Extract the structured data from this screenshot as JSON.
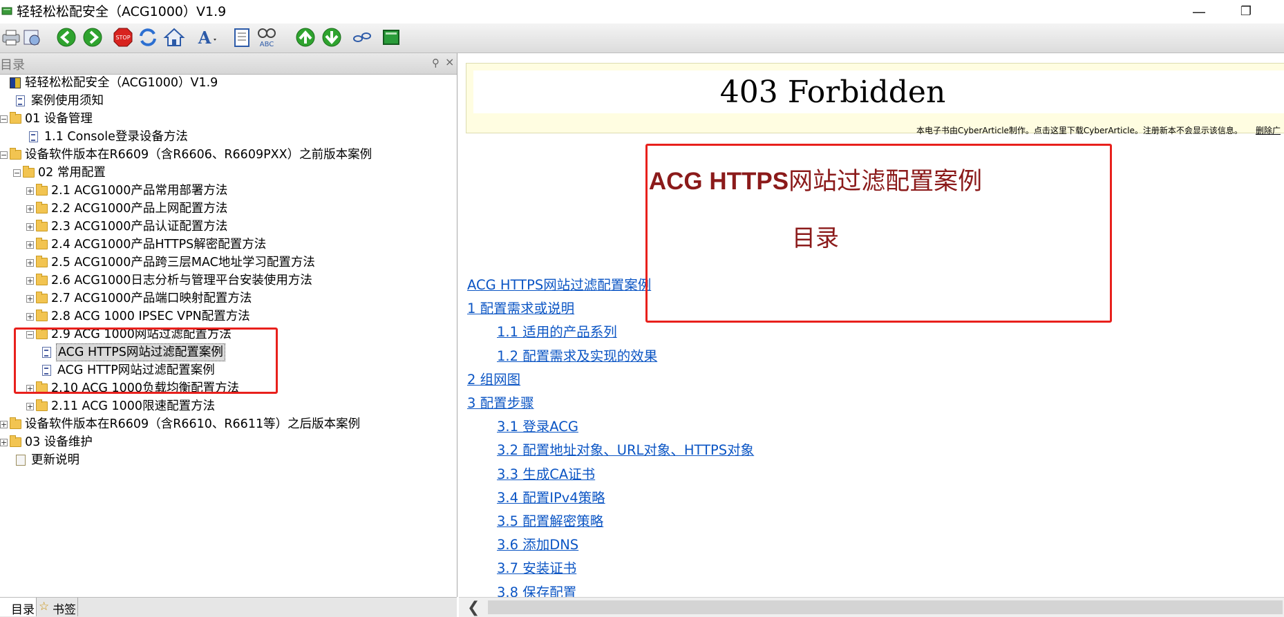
{
  "window": {
    "title": "轻轻松松配安全（ACG1000）V1.9",
    "minimize_glyph": "—",
    "restore_glyph": "❐"
  },
  "toolbar": {
    "buttons": [
      "print-icon",
      "options-icon",
      "back-icon",
      "forward-icon",
      "stop-icon",
      "refresh-icon",
      "home-icon",
      "font-icon",
      "notes-icon",
      "spell-check-icon",
      "up-icon",
      "down-icon",
      "link-icon",
      "book-icon"
    ]
  },
  "toc_pane": {
    "header": "目录",
    "tabs": {
      "toc": "目录",
      "bookmarks": "书签"
    },
    "tree": [
      {
        "label": "轻轻松松配安全（ACG1000）V1.9",
        "level": 0,
        "icon": "book",
        "exp": ""
      },
      {
        "label": "案例使用须知",
        "level": 1,
        "icon": "page",
        "exp": ""
      },
      {
        "label": "01 设备管理",
        "level": 0,
        "icon": "folder",
        "exp": "−"
      },
      {
        "label": "1.1 Console登录设备方法",
        "level": 2,
        "icon": "page",
        "exp": ""
      },
      {
        "label": "设备软件版本在R6609（含R6606、R6609PXX）之前版本案例",
        "level": 0,
        "icon": "folder",
        "exp": "−"
      },
      {
        "label": "02 常用配置",
        "level": 1,
        "icon": "folder",
        "exp": "−"
      },
      {
        "label": "2.1 ACG1000产品常用部署方法",
        "level": 2,
        "icon": "folder",
        "exp": "+"
      },
      {
        "label": "2.2 ACG1000产品上网配置方法",
        "level": 2,
        "icon": "folder",
        "exp": "+"
      },
      {
        "label": "2.3 ACG1000产品认证配置方法",
        "level": 2,
        "icon": "folder",
        "exp": "+"
      },
      {
        "label": "2.4 ACG1000产品HTTPS解密配置方法",
        "level": 2,
        "icon": "folder",
        "exp": "+"
      },
      {
        "label": "2.5 ACG1000产品跨三层MAC地址学习配置方法",
        "level": 2,
        "icon": "folder",
        "exp": "+"
      },
      {
        "label": "2.6 ACG1000日志分析与管理平台安装使用方法",
        "level": 2,
        "icon": "folder",
        "exp": "+"
      },
      {
        "label": "2.7 ACG1000产品端口映射配置方法",
        "level": 2,
        "icon": "folder",
        "exp": "+"
      },
      {
        "label": "2.8 ACG 1000 IPSEC VPN配置方法",
        "level": 2,
        "icon": "folder",
        "exp": "+"
      },
      {
        "label": "2.9 ACG 1000网站过滤配置方法",
        "level": 2,
        "icon": "folder",
        "exp": "−"
      },
      {
        "label": "ACG HTTPS网站过滤配置案例",
        "level": 3,
        "icon": "page",
        "exp": "",
        "selected": true
      },
      {
        "label": "ACG HTTP网站过滤配置案例",
        "level": 3,
        "icon": "page",
        "exp": ""
      },
      {
        "label": "2.10 ACG 1000负载均衡配置方法",
        "level": 2,
        "icon": "folder",
        "exp": "+"
      },
      {
        "label": "2.11 ACG 1000限速配置方法",
        "level": 2,
        "icon": "folder",
        "exp": "+"
      },
      {
        "label": "设备软件版本在R6609（含R6610、R6611等）之后版本案例",
        "level": 0,
        "icon": "folder",
        "exp": "+"
      },
      {
        "label": "03 设备维护",
        "level": 0,
        "icon": "folder",
        "exp": "+"
      },
      {
        "label": "更新说明",
        "level": 1,
        "icon": "note",
        "exp": ""
      }
    ]
  },
  "content": {
    "banner_text": "403 Forbidden",
    "cyber_note": "本电子书由CyberArticle制作。点击这里下载CyberArticle。注册新本不会显示该信息。",
    "cyber_delete": "删除广",
    "doc_title_latin": "ACG HTTPS",
    "doc_title_cn": "网站过滤配置案例",
    "toc_heading": "目录",
    "links": [
      {
        "text": "ACG HTTPS网站过滤配置案例",
        "indent": 1
      },
      {
        "text": "1 配置需求或说明",
        "indent": 1
      },
      {
        "text": "1.1 适用的产品系列",
        "indent": 2
      },
      {
        "text": "1.2 配置需求及实现的效果",
        "indent": 2
      },
      {
        "text": "2 组网图",
        "indent": 1
      },
      {
        "text": "3 配置步骤",
        "indent": 1
      },
      {
        "text": "3.1 登录ACG",
        "indent": 2
      },
      {
        "text": "3.2 配置地址对象、URL对象、HTTPS对象",
        "indent": 2
      },
      {
        "text": "3.3 生成CA证书",
        "indent": 2
      },
      {
        "text": "3.4 配置IPv4策略",
        "indent": 2
      },
      {
        "text": "3.5 配置解密策略",
        "indent": 2
      },
      {
        "text": "3.6 添加DNS",
        "indent": 2
      },
      {
        "text": "3.7 安装证书",
        "indent": 2
      },
      {
        "text": "3.8 保存配置",
        "indent": 2
      }
    ]
  },
  "colors": {
    "annotation_red": "#e8201c",
    "link_blue": "#0b55c4",
    "title_dark_red": "#8b1a1a"
  }
}
